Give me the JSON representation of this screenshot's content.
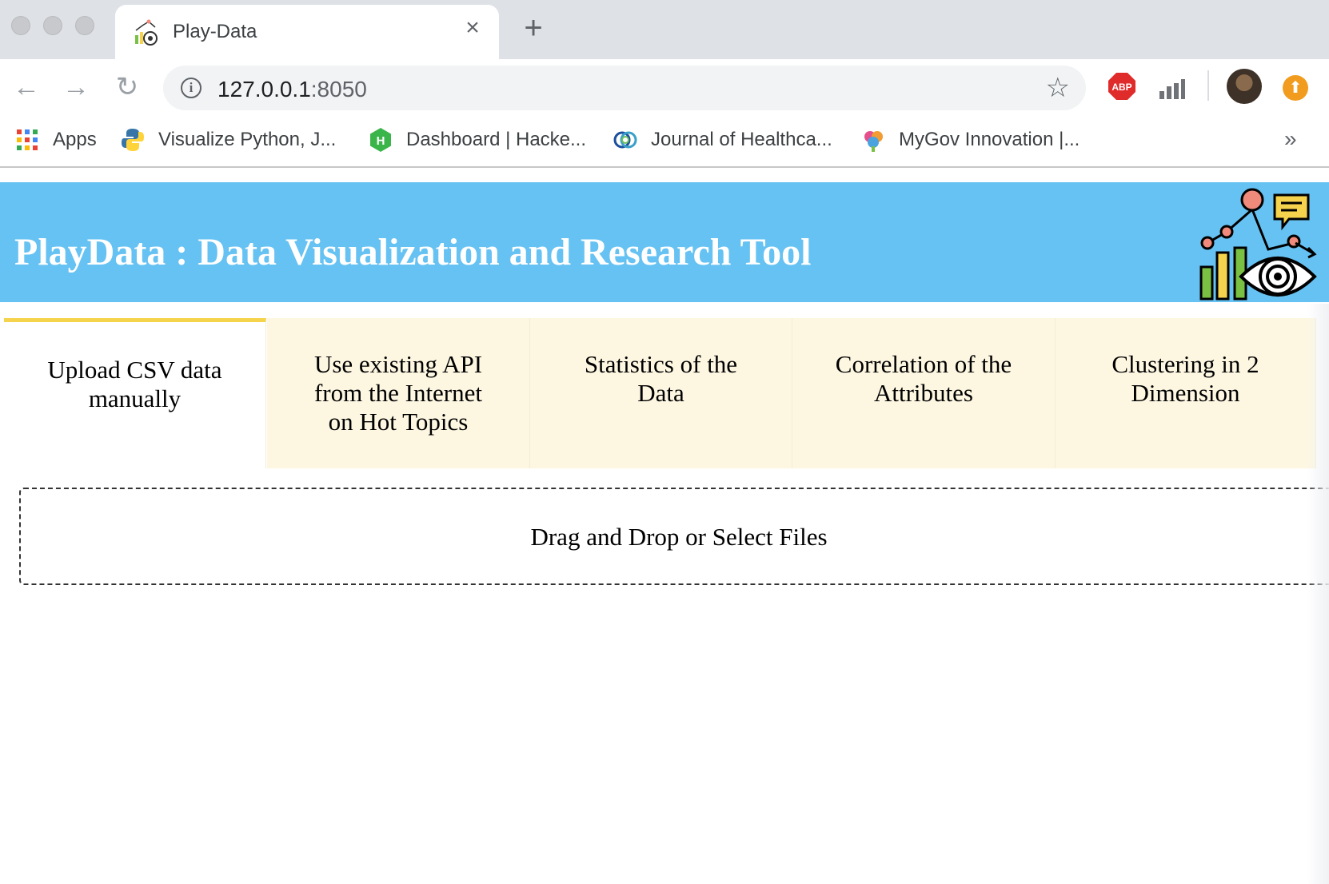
{
  "browser": {
    "tab_title": "Play-Data",
    "tab_close_glyph": "×",
    "new_tab_glyph": "+",
    "nav": {
      "back_glyph": "←",
      "forward_glyph": "→",
      "reload_glyph": "↻"
    },
    "url_host": "127.0.0.1",
    "url_port": ":8050",
    "star_glyph": "☆",
    "extensions": {
      "abp_label": "ABP",
      "update_glyph": "⬆"
    },
    "bookmarks": [
      {
        "label": "Apps",
        "icon": "apps-grid-icon"
      },
      {
        "label": "Visualize Python, J...",
        "icon": "python-icon"
      },
      {
        "label": "Dashboard | Hacke...",
        "icon": "hackerrank-icon"
      },
      {
        "label": "Journal of Healthca...",
        "icon": "journal-rings-icon"
      },
      {
        "label": "MyGov Innovation |...",
        "icon": "mygov-icon"
      }
    ],
    "bookmarks_more_glyph": "»"
  },
  "header": {
    "title": "PlayData : Data Visualization and Research Tool",
    "logo_icon": "data-eye-chart-icon"
  },
  "tabs": [
    {
      "label": "Upload CSV data manually",
      "selected": true
    },
    {
      "label": "Use existing API from the Internet on Hot Topics",
      "selected": false
    },
    {
      "label": "Statistics of the Data",
      "selected": false
    },
    {
      "label": "Correlation of the Attributes",
      "selected": false
    },
    {
      "label": "Clustering in 2 Dimension",
      "selected": false
    }
  ],
  "upload": {
    "prompt": "Drag and Drop or Select Files"
  },
  "colors": {
    "banner": "#66c2f2",
    "tab_background": "#fdf7e2",
    "selected_tab_accent": "#f6d34c"
  }
}
